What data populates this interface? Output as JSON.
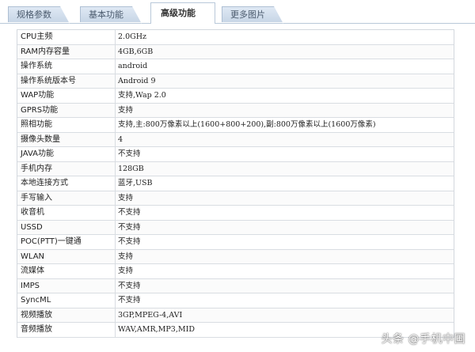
{
  "tabs": [
    {
      "label": "规格参数"
    },
    {
      "label": "基本功能"
    },
    {
      "label": "高级功能",
      "active": true
    },
    {
      "label": "更多图片"
    }
  ],
  "spec_rows": [
    {
      "label": "CPU主频",
      "value": "2.0GHz"
    },
    {
      "label": "RAM内存容量",
      "value": "4GB,6GB"
    },
    {
      "label": "操作系统",
      "value": "android"
    },
    {
      "label": "操作系统版本号",
      "value": "Android 9"
    },
    {
      "label": "WAP功能",
      "value": "支持,Wap 2.0"
    },
    {
      "label": "GPRS功能",
      "value": "支持"
    },
    {
      "label": "照相功能",
      "value": "支持,主:800万像素以上(1600+800+200),副:800万像素以上(1600万像素)"
    },
    {
      "label": "摄像头数量",
      "value": "4"
    },
    {
      "label": "JAVA功能",
      "value": "不支持"
    },
    {
      "label": "手机内存",
      "value": "128GB"
    },
    {
      "label": "本地连接方式",
      "value": "蓝牙,USB"
    },
    {
      "label": "手写输入",
      "value": "支持"
    },
    {
      "label": "收音机",
      "value": "不支持"
    },
    {
      "label": "USSD",
      "value": "不支持"
    },
    {
      "label": "POC(PTT)一键通",
      "value": "不支持"
    },
    {
      "label": "WLAN",
      "value": "支持"
    },
    {
      "label": "流媒体",
      "value": "支持"
    },
    {
      "label": "IMPS",
      "value": "不支持"
    },
    {
      "label": "SyncML",
      "value": "不支持"
    },
    {
      "label": "视频播放",
      "value": "3GP,MPEG-4,AVI"
    },
    {
      "label": "音频播放",
      "value": "WAV,AMR,MP3,MID"
    }
  ],
  "watermark": "头条 @手机中国"
}
